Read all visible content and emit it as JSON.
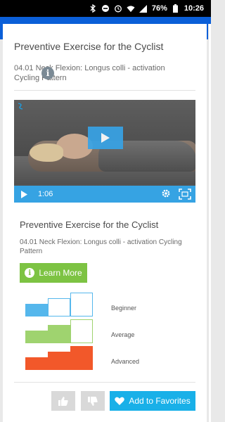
{
  "status_bar": {
    "battery": "76%",
    "time": "10:26",
    "icons": [
      "bluetooth-icon",
      "dnd-icon",
      "alarm-icon",
      "wifi-icon",
      "signal-icon",
      "battery-icon"
    ]
  },
  "header": {
    "color": "#0b5fd8"
  },
  "exercise": {
    "title": "Preventive Exercise for the Cyclist",
    "subtitle": "04.01 Neck Flexion: Longus colli - activation Cycling Pattern"
  },
  "video": {
    "time": "1:06",
    "accent": "#36a3e3"
  },
  "detail": {
    "title": "Preventive Exercise for the Cyclist",
    "subtitle": "04.01 Neck Flexion: Longus colli - activation Cycling Pattern",
    "learn_more_label": "Learn More"
  },
  "levels": [
    {
      "label": "Beginner",
      "color": "#55b7ec",
      "filled_bars": 1,
      "total_bars": 3
    },
    {
      "label": "Average",
      "color": "#9fd36f",
      "filled_bars": 2,
      "total_bars": 3
    },
    {
      "label": "Advanced",
      "color": "#f2582a",
      "filled_bars": 3,
      "total_bars": 3
    }
  ],
  "actions": {
    "favorites_label": "Add to Favorites",
    "favorites_color": "#19b0e8"
  }
}
